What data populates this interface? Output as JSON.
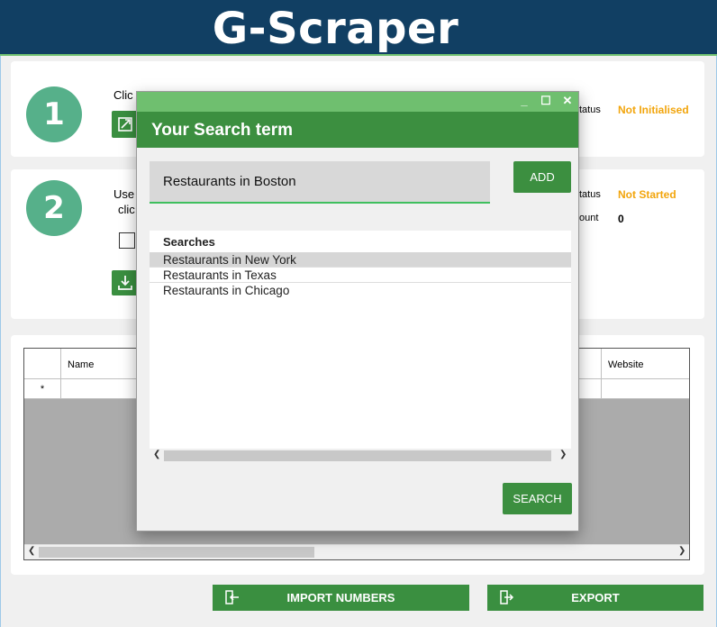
{
  "app": {
    "title": "G-Scraper"
  },
  "step1": {
    "number": "1",
    "instruction": "Clic",
    "status_label": "tatus",
    "status_value": "Not Initialised"
  },
  "step2": {
    "number": "2",
    "instruction_line1": "Use",
    "instruction_line2": "clic",
    "status_label": "tatus",
    "status_value": "Not Started",
    "count_label": "ount",
    "count_value": "0"
  },
  "grid": {
    "columns": [
      "Name",
      "Website"
    ],
    "new_row_marker": "*"
  },
  "buttons": {
    "import_label": "IMPORT NUMBERS",
    "export_label": "EXPORT"
  },
  "dialog": {
    "heading": "Your Search term",
    "controls": {
      "minimize": "_",
      "maximize": "☐",
      "close": "✕"
    },
    "search_value": "Restaurants in Boston",
    "add_label": "ADD",
    "list_header": "Searches",
    "searches": [
      "Restaurants in New York",
      "Restaurants in Texas",
      "Restaurants in Chicago"
    ],
    "search_label": "SEARCH"
  },
  "colors": {
    "header_bg": "#113f63",
    "accent_green": "#3c8f40",
    "status_orange": "#f2a50c",
    "step_circle": "#56b08a"
  }
}
